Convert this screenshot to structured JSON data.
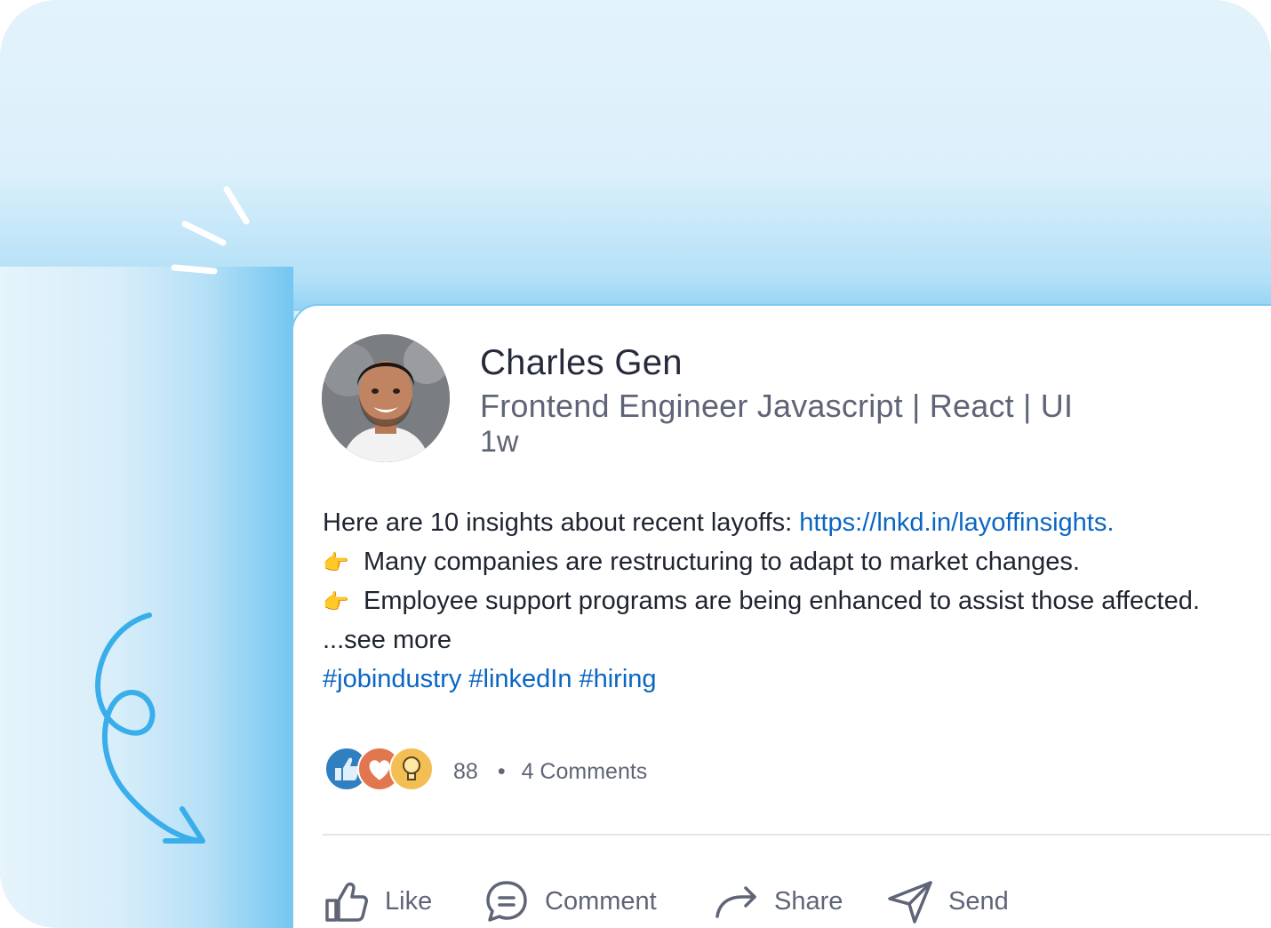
{
  "post": {
    "author": {
      "name": "Charles Gen",
      "headline": "Frontend Engineer Javascript | React | UI",
      "time": "1w",
      "avatar": "avatar-photo"
    },
    "body": {
      "intro": "Here are 10 insights about recent layoffs: ",
      "link": "https://lnkd.in/layoffinsights.",
      "points": [
        "Many companies are restructuring to adapt to market changes.",
        "Employee support programs are being enhanced to assist those affected."
      ],
      "point_icon": "pointing-hand-icon",
      "see_more": "...see more"
    },
    "hashtags": [
      "#jobindustry",
      "#linkedIn",
      "#hiring"
    ],
    "reactions": {
      "icons": [
        "like-icon",
        "love-icon",
        "insightful-icon"
      ],
      "count": "88",
      "separator": "•",
      "comments": "4 Comments"
    },
    "actions": [
      {
        "label": "Like",
        "icon": "thumbs-up-icon"
      },
      {
        "label": "Comment",
        "icon": "comment-icon"
      },
      {
        "label": "Share",
        "icon": "share-arrow-icon"
      },
      {
        "label": "Send",
        "icon": "send-icon"
      }
    ]
  },
  "colors": {
    "link": "#0b66c2",
    "accent_blue": "#3aaeea",
    "text_primary": "#262a3b",
    "text_secondary": "#5f6577"
  }
}
